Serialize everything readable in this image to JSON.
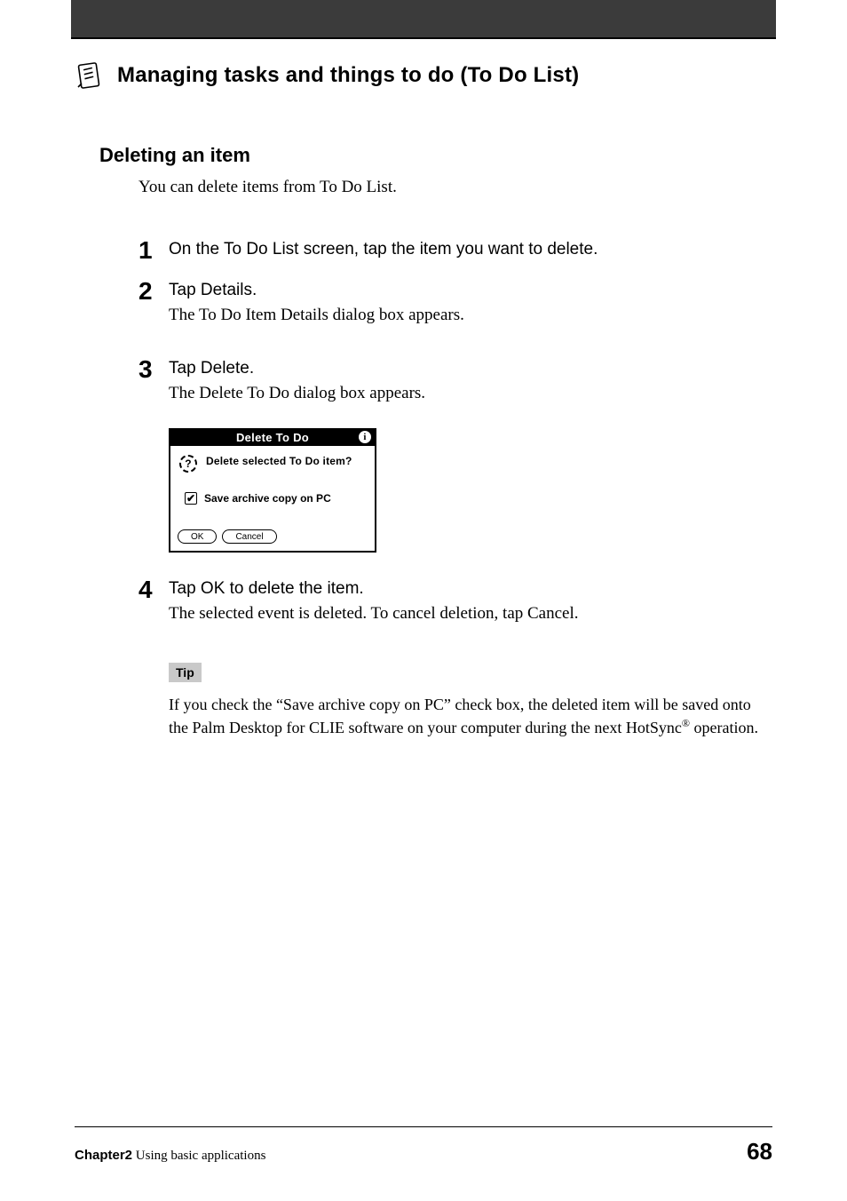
{
  "header": {
    "title": "Managing tasks and things to do (To Do List)"
  },
  "section": {
    "title": "Deleting an item",
    "intro": "You can delete items from To Do List."
  },
  "steps": [
    {
      "num": "1",
      "instruction": "On the To Do List screen, tap the item you want to delete."
    },
    {
      "num": "2",
      "instruction": "Tap Details.",
      "desc": "The To Do Item Details dialog box appears."
    },
    {
      "num": "3",
      "instruction": "Tap Delete.",
      "desc": "The Delete To Do dialog box appears."
    },
    {
      "num": "4",
      "instruction": "Tap OK to delete the item.",
      "desc": "The selected event is deleted. To cancel deletion, tap Cancel."
    }
  ],
  "dialog": {
    "title": "Delete To Do",
    "info_icon_label": "i",
    "question_icon_label": "?",
    "message": "Delete selected To Do item?",
    "checkbox_label": "Save archive copy on PC",
    "checkbox_checked": true,
    "ok_label": "OK",
    "cancel_label": "Cancel"
  },
  "tip": {
    "label": "Tip",
    "text_before": "If you check the “Save archive copy on PC” check box, the deleted item will be saved onto the Palm Desktop for CLIE software on your computer during the next HotSync",
    "reg": "®",
    "text_after": " operation."
  },
  "footer": {
    "chapter_label": "Chapter2",
    "chapter_text": "  Using basic applications",
    "page_number": "68"
  }
}
